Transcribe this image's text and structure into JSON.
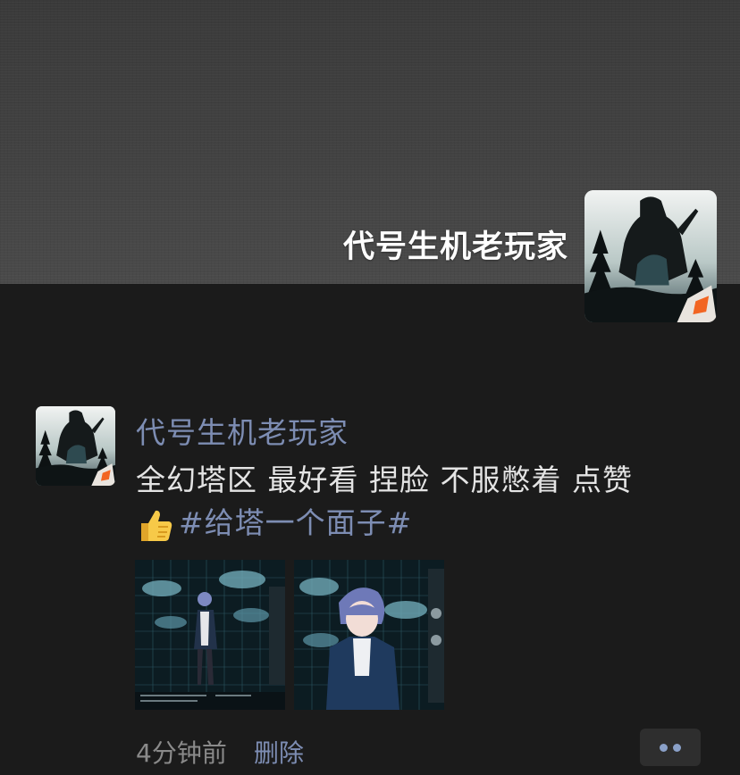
{
  "profile": {
    "name": "代号生机老玩家",
    "avatar_icon": "forest-silhouette-avatar"
  },
  "post": {
    "author": "代号生机老玩家",
    "text_line1": "全幻塔区 最好看 捏脸 不服憋着 点赞",
    "emoji": "thumbs-up-emoji",
    "hashtag": "#给塔一个面子#",
    "time": "4分钟前",
    "delete_label": "删除",
    "more_icon": "more-dots-icon"
  },
  "colors": {
    "link": "#7d8db3",
    "background": "#1b1b1b",
    "cover": "#424242"
  }
}
